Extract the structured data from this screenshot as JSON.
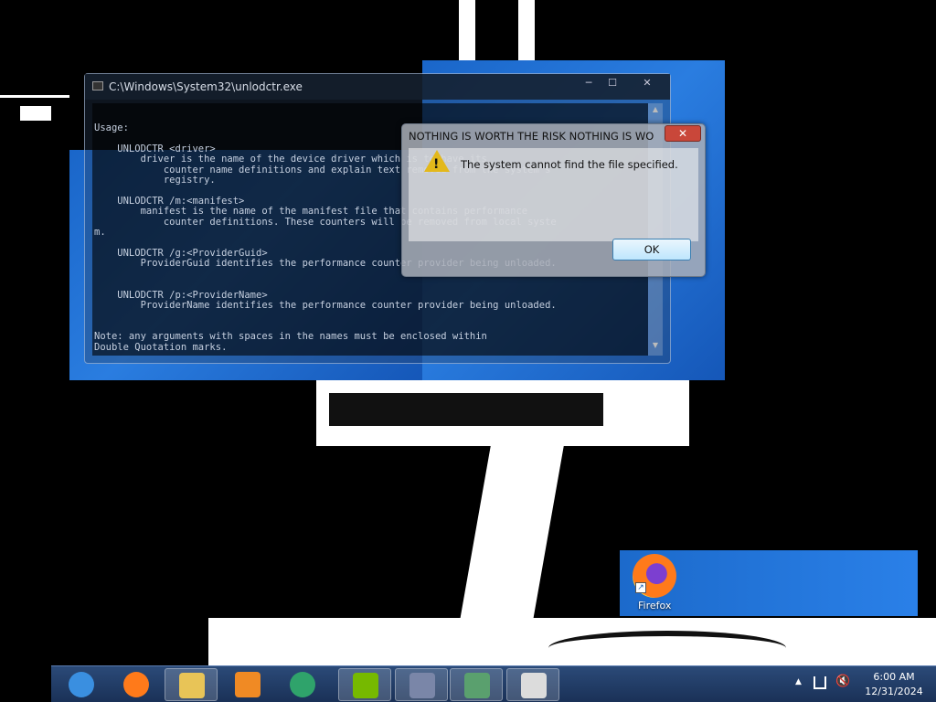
{
  "console_window": {
    "title": "C:\\Windows\\System32\\unlodctr.exe",
    "minimize": "─",
    "maximize": "☐",
    "close": "✕",
    "lines": [
      "Usage:",
      "",
      "    UNLODCTR <driver>",
      "        driver is the name of the device driver which is to have its",
      "            counter name definitions and explain text removed from the system's",
      "            registry.",
      "",
      "    UNLODCTR /m:<manifest>",
      "        manifest is the name of the manifest file that contains performance",
      "            counter definitions. These counters will be removed from local syste",
      "m.",
      "",
      "    UNLODCTR /g:<ProviderGuid>",
      "        ProviderGuid identifies the performance counter provider being unloaded.",
      "",
      "",
      "    UNLODCTR /p:<ProviderName>",
      "        ProviderName identifies the performance counter provider being unloaded.",
      "",
      "",
      "Note: any arguments with spaces in the names must be enclosed within",
      "Double Quotation marks."
    ]
  },
  "message_box": {
    "title": "NOTHING IS WORTH THE RISK NOTHING IS WO...",
    "close": "✕",
    "icon": "warning-icon",
    "message": "The system cannot find the file specified.",
    "ok_label": "OK"
  },
  "desktop": {
    "firefox_icon_label": "Firefox"
  },
  "taskbar": {
    "items": [
      {
        "name": "internet-explorer",
        "icon": "ie-icon",
        "color": "#3a8fe0"
      },
      {
        "name": "firefox",
        "icon": "firefox-icon",
        "color": "#ff7a1a"
      },
      {
        "name": "file-explorer",
        "icon": "folder-icon",
        "color": "#e8c457"
      },
      {
        "name": "media-player",
        "icon": "media-icon",
        "color": "#f08a24"
      },
      {
        "name": "app-green",
        "icon": "green-circle-icon",
        "color": "#2fa36b"
      },
      {
        "name": "nvidia",
        "icon": "nvidia-icon",
        "color": "#76b900"
      },
      {
        "name": "terminal",
        "icon": "terminal-icon",
        "color": "#7a86a8"
      },
      {
        "name": "notepad-app",
        "icon": "document-icon",
        "color": "#5aa06e"
      },
      {
        "name": "text-editor",
        "icon": "editor-icon",
        "color": "#dcdcdc"
      }
    ],
    "tray": {
      "time": "6:00 AM",
      "date": "12/31/2024",
      "show_hidden": "▲",
      "volume": "🔇"
    }
  }
}
